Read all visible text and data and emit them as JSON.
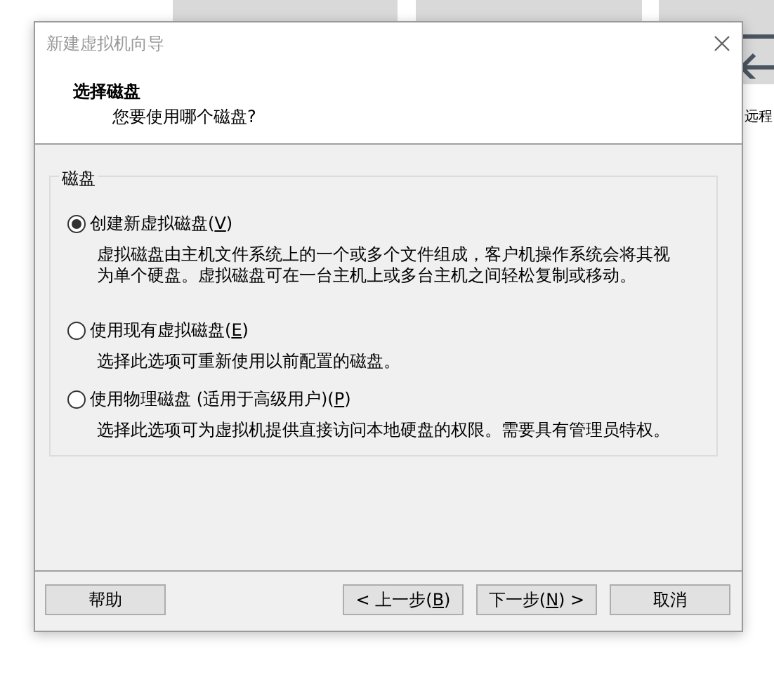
{
  "background": {
    "side_label": "远程"
  },
  "window": {
    "title": "新建虚拟机向导"
  },
  "header": {
    "title": "选择磁盘",
    "subtitle": "您要使用哪个磁盘?"
  },
  "group": {
    "label": "磁盘",
    "options": [
      {
        "text": "创建新虚拟磁盘(",
        "key": "V",
        "tail": ")",
        "selected": true,
        "description": "虚拟磁盘由主机文件系统上的一个或多个文件组成，客户机操作系统会将其视为单个硬盘。虚拟磁盘可在一台主机上或多台主机之间轻松复制或移动。"
      },
      {
        "text": "使用现有虚拟磁盘(",
        "key": "E",
        "tail": ")",
        "selected": false,
        "description": "选择此选项可重新使用以前配置的磁盘。"
      },
      {
        "text": "使用物理磁盘 (适用于高级用户)(",
        "key": "P",
        "tail": ")",
        "selected": false,
        "description": "选择此选项可为虚拟机提供直接访问本地硬盘的权限。需要具有管理员特权。"
      }
    ]
  },
  "buttons": [
    {
      "text": "帮助",
      "kind": "left"
    },
    {
      "text": "< 上一步(",
      "key": "B",
      "tail": ")",
      "kind": "right"
    },
    {
      "text": "下一步(",
      "key": "N",
      "tail": ") >",
      "kind": "right"
    },
    {
      "text": "取消",
      "kind": "right"
    }
  ]
}
